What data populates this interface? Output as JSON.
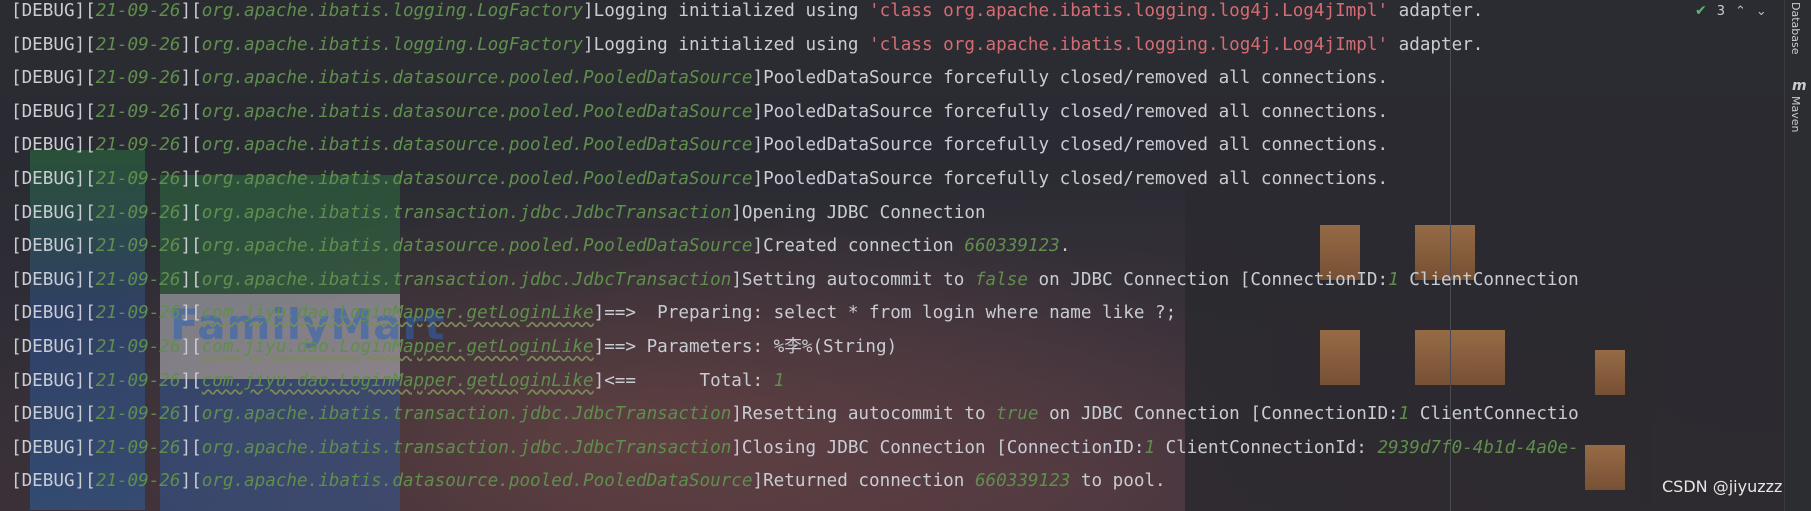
{
  "console": {
    "lines": [
      {
        "tag": "[DEBUG]",
        "date": "21-09-26",
        "cls": "org.apache.ibatis.logging.LogFactory",
        "a": "Logging initialized using ",
        "s": "'class org.apache.ibatis.logging.log4j.Log4jImpl'",
        "b": " adapter."
      },
      {
        "tag": "[DEBUG]",
        "date": "21-09-26",
        "cls": "org.apache.ibatis.logging.LogFactory",
        "a": "Logging initialized using ",
        "s": "'class org.apache.ibatis.logging.log4j.Log4jImpl'",
        "b": " adapter."
      },
      {
        "tag": "[DEBUG]",
        "date": "21-09-26",
        "cls": "org.apache.ibatis.datasource.pooled.PooledDataSource",
        "a": "PooledDataSource forcefully closed/removed all connections."
      },
      {
        "tag": "[DEBUG]",
        "date": "21-09-26",
        "cls": "org.apache.ibatis.datasource.pooled.PooledDataSource",
        "a": "PooledDataSource forcefully closed/removed all connections."
      },
      {
        "tag": "[DEBUG]",
        "date": "21-09-26",
        "cls": "org.apache.ibatis.datasource.pooled.PooledDataSource",
        "a": "PooledDataSource forcefully closed/removed all connections."
      },
      {
        "tag": "[DEBUG]",
        "date": "21-09-26",
        "cls": "org.apache.ibatis.datasource.pooled.PooledDataSource",
        "a": "PooledDataSource forcefully closed/removed all connections."
      },
      {
        "tag": "[DEBUG]",
        "date": "21-09-26",
        "cls": "org.apache.ibatis.transaction.jdbc.JdbcTransaction",
        "a": "Opening JDBC Connection"
      },
      {
        "tag": "[DEBUG]",
        "date": "21-09-26",
        "cls": "org.apache.ibatis.datasource.pooled.PooledDataSource",
        "a": "Created connection ",
        "n": "660339123",
        "b": "."
      },
      {
        "tag": "[DEBUG]",
        "date": "21-09-26",
        "cls": "org.apache.ibatis.transaction.jdbc.JdbcTransaction",
        "a": "Setting autocommit to ",
        "n": "false",
        "b": " on JDBC Connection [ConnectionID:",
        "n2": "1",
        "c": " ClientConnection"
      },
      {
        "tag": "[DEBUG]",
        "date": "21-09-26",
        "cls": "com.jiyu.dao.LoginMapper.getLoginLike",
        "a": "==>  Preparing: select * from login where name like ?;"
      },
      {
        "tag": "[DEBUG]",
        "date": "21-09-26",
        "cls": "com.jiyu.dao.LoginMapper.getLoginLike",
        "a": "==> Parameters: %李%(String)"
      },
      {
        "tag": "[DEBUG]",
        "date": "21-09-26",
        "cls": "com.jiyu.dao.LoginMapper.getLoginLike",
        "a": "<==      Total: ",
        "n": "1"
      },
      {
        "tag": "[DEBUG]",
        "date": "21-09-26",
        "cls": "org.apache.ibatis.transaction.jdbc.JdbcTransaction",
        "a": "Resetting autocommit to ",
        "n": "true",
        "b": " on JDBC Connection [ConnectionID:",
        "n2": "1",
        "c": " ClientConnectio"
      },
      {
        "tag": "[DEBUG]",
        "date": "21-09-26",
        "cls": "org.apache.ibatis.transaction.jdbc.JdbcTransaction",
        "a": "Closing JDBC Connection [ConnectionID:",
        "n": "1",
        "b": " ClientConnectionId: ",
        "n2": "2939d7f0-4b1d-4a0e-"
      },
      {
        "tag": "[DEBUG]",
        "date": "21-09-26",
        "cls": "org.apache.ibatis.datasource.pooled.PooledDataSource",
        "a": "Returned connection ",
        "n": "660339123",
        "b": " to pool."
      }
    ]
  },
  "inspection": {
    "count": "3",
    "up": "⌃",
    "down": "⌄"
  },
  "toolstrip": {
    "database": "Database",
    "maven": "Maven",
    "maven_letter": "m"
  },
  "background_sign": "FamilyMart",
  "watermark": "CSDN @jiyuzzz",
  "colors": {
    "green": "#5f8e4d",
    "string": "#d56b73",
    "text": "#c9ccd3"
  }
}
